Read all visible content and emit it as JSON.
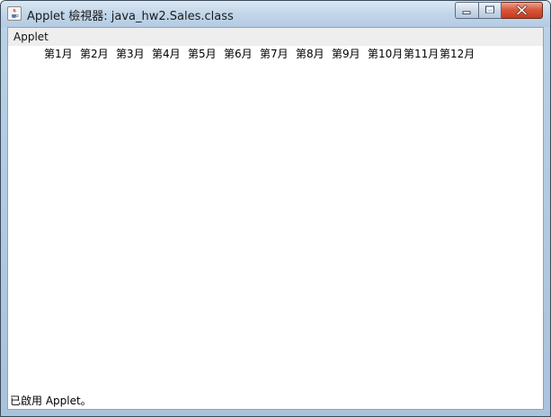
{
  "window": {
    "title": "Applet 檢視器: java_hw2.Sales.class",
    "app_icon": "java-coffee-icon",
    "controls": {
      "minimize": "minimize-icon",
      "maximize": "maximize-icon",
      "close": "close-icon"
    }
  },
  "menubar": {
    "items": [
      {
        "label": "Applet"
      }
    ]
  },
  "applet": {
    "months": [
      "第1月",
      "第2月",
      "第3月",
      "第4月",
      "第5月",
      "第6月",
      "第7月",
      "第8月",
      "第9月",
      "第10月",
      "第11月",
      "第12月"
    ]
  },
  "status": {
    "text": "已啟用 Applet。"
  },
  "colors": {
    "titlebar": "#c3d7ea",
    "close_button": "#d9583d",
    "client_background": "#ffffff",
    "menubar_background": "#eeeeee"
  }
}
